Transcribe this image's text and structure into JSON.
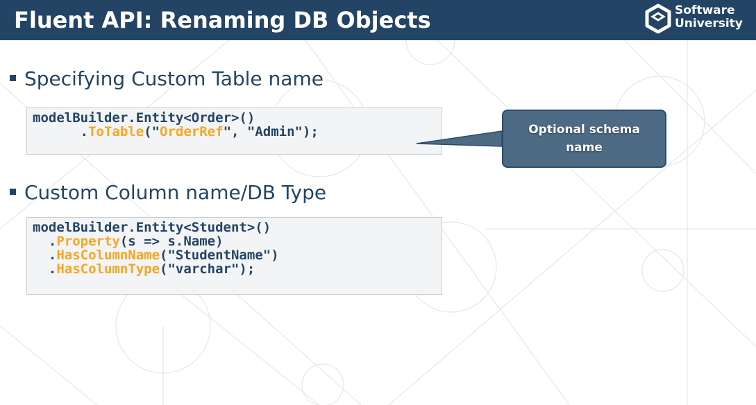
{
  "header": {
    "title": "Fluent API: Renaming DB Objects",
    "background_color": "#234465"
  },
  "logo": {
    "icon": "software-university-logo-icon",
    "line1": "Software",
    "line2": "University"
  },
  "bullets": [
    "Specifying Custom Table name",
    "Custom Column name/DB Type"
  ],
  "code_blocks": [
    {
      "lines": [
        [
          {
            "t": "modelBuilder.Entity<Order>()",
            "hl": false
          }
        ],
        [
          {
            "t": "      .",
            "hl": false
          },
          {
            "t": "ToTable",
            "hl": true
          },
          {
            "t": "(\"",
            "hl": false
          },
          {
            "t": "OrderRef",
            "hl": true
          },
          {
            "t": "\", \"Admin\");",
            "hl": false
          }
        ]
      ]
    },
    {
      "lines": [
        [
          {
            "t": "modelBuilder.Entity<Student>()",
            "hl": false
          }
        ],
        [
          {
            "t": "  .",
            "hl": false
          },
          {
            "t": "Property",
            "hl": true
          },
          {
            "t": "(s => s.Name)",
            "hl": false
          }
        ],
        [
          {
            "t": "  .",
            "hl": false
          },
          {
            "t": "HasColumnName",
            "hl": true
          },
          {
            "t": "(\"StudentName\")",
            "hl": false
          }
        ],
        [
          {
            "t": "  .",
            "hl": false
          },
          {
            "t": "HasColumnType",
            "hl": true
          },
          {
            "t": "(\"varchar\");",
            "hl": false
          }
        ]
      ]
    }
  ],
  "callout": {
    "line1": "Optional schema",
    "line2": "name"
  },
  "colors": {
    "code_highlight": "#f6a623",
    "code_text": "#234465",
    "callout_fill": "#4e6b86"
  }
}
